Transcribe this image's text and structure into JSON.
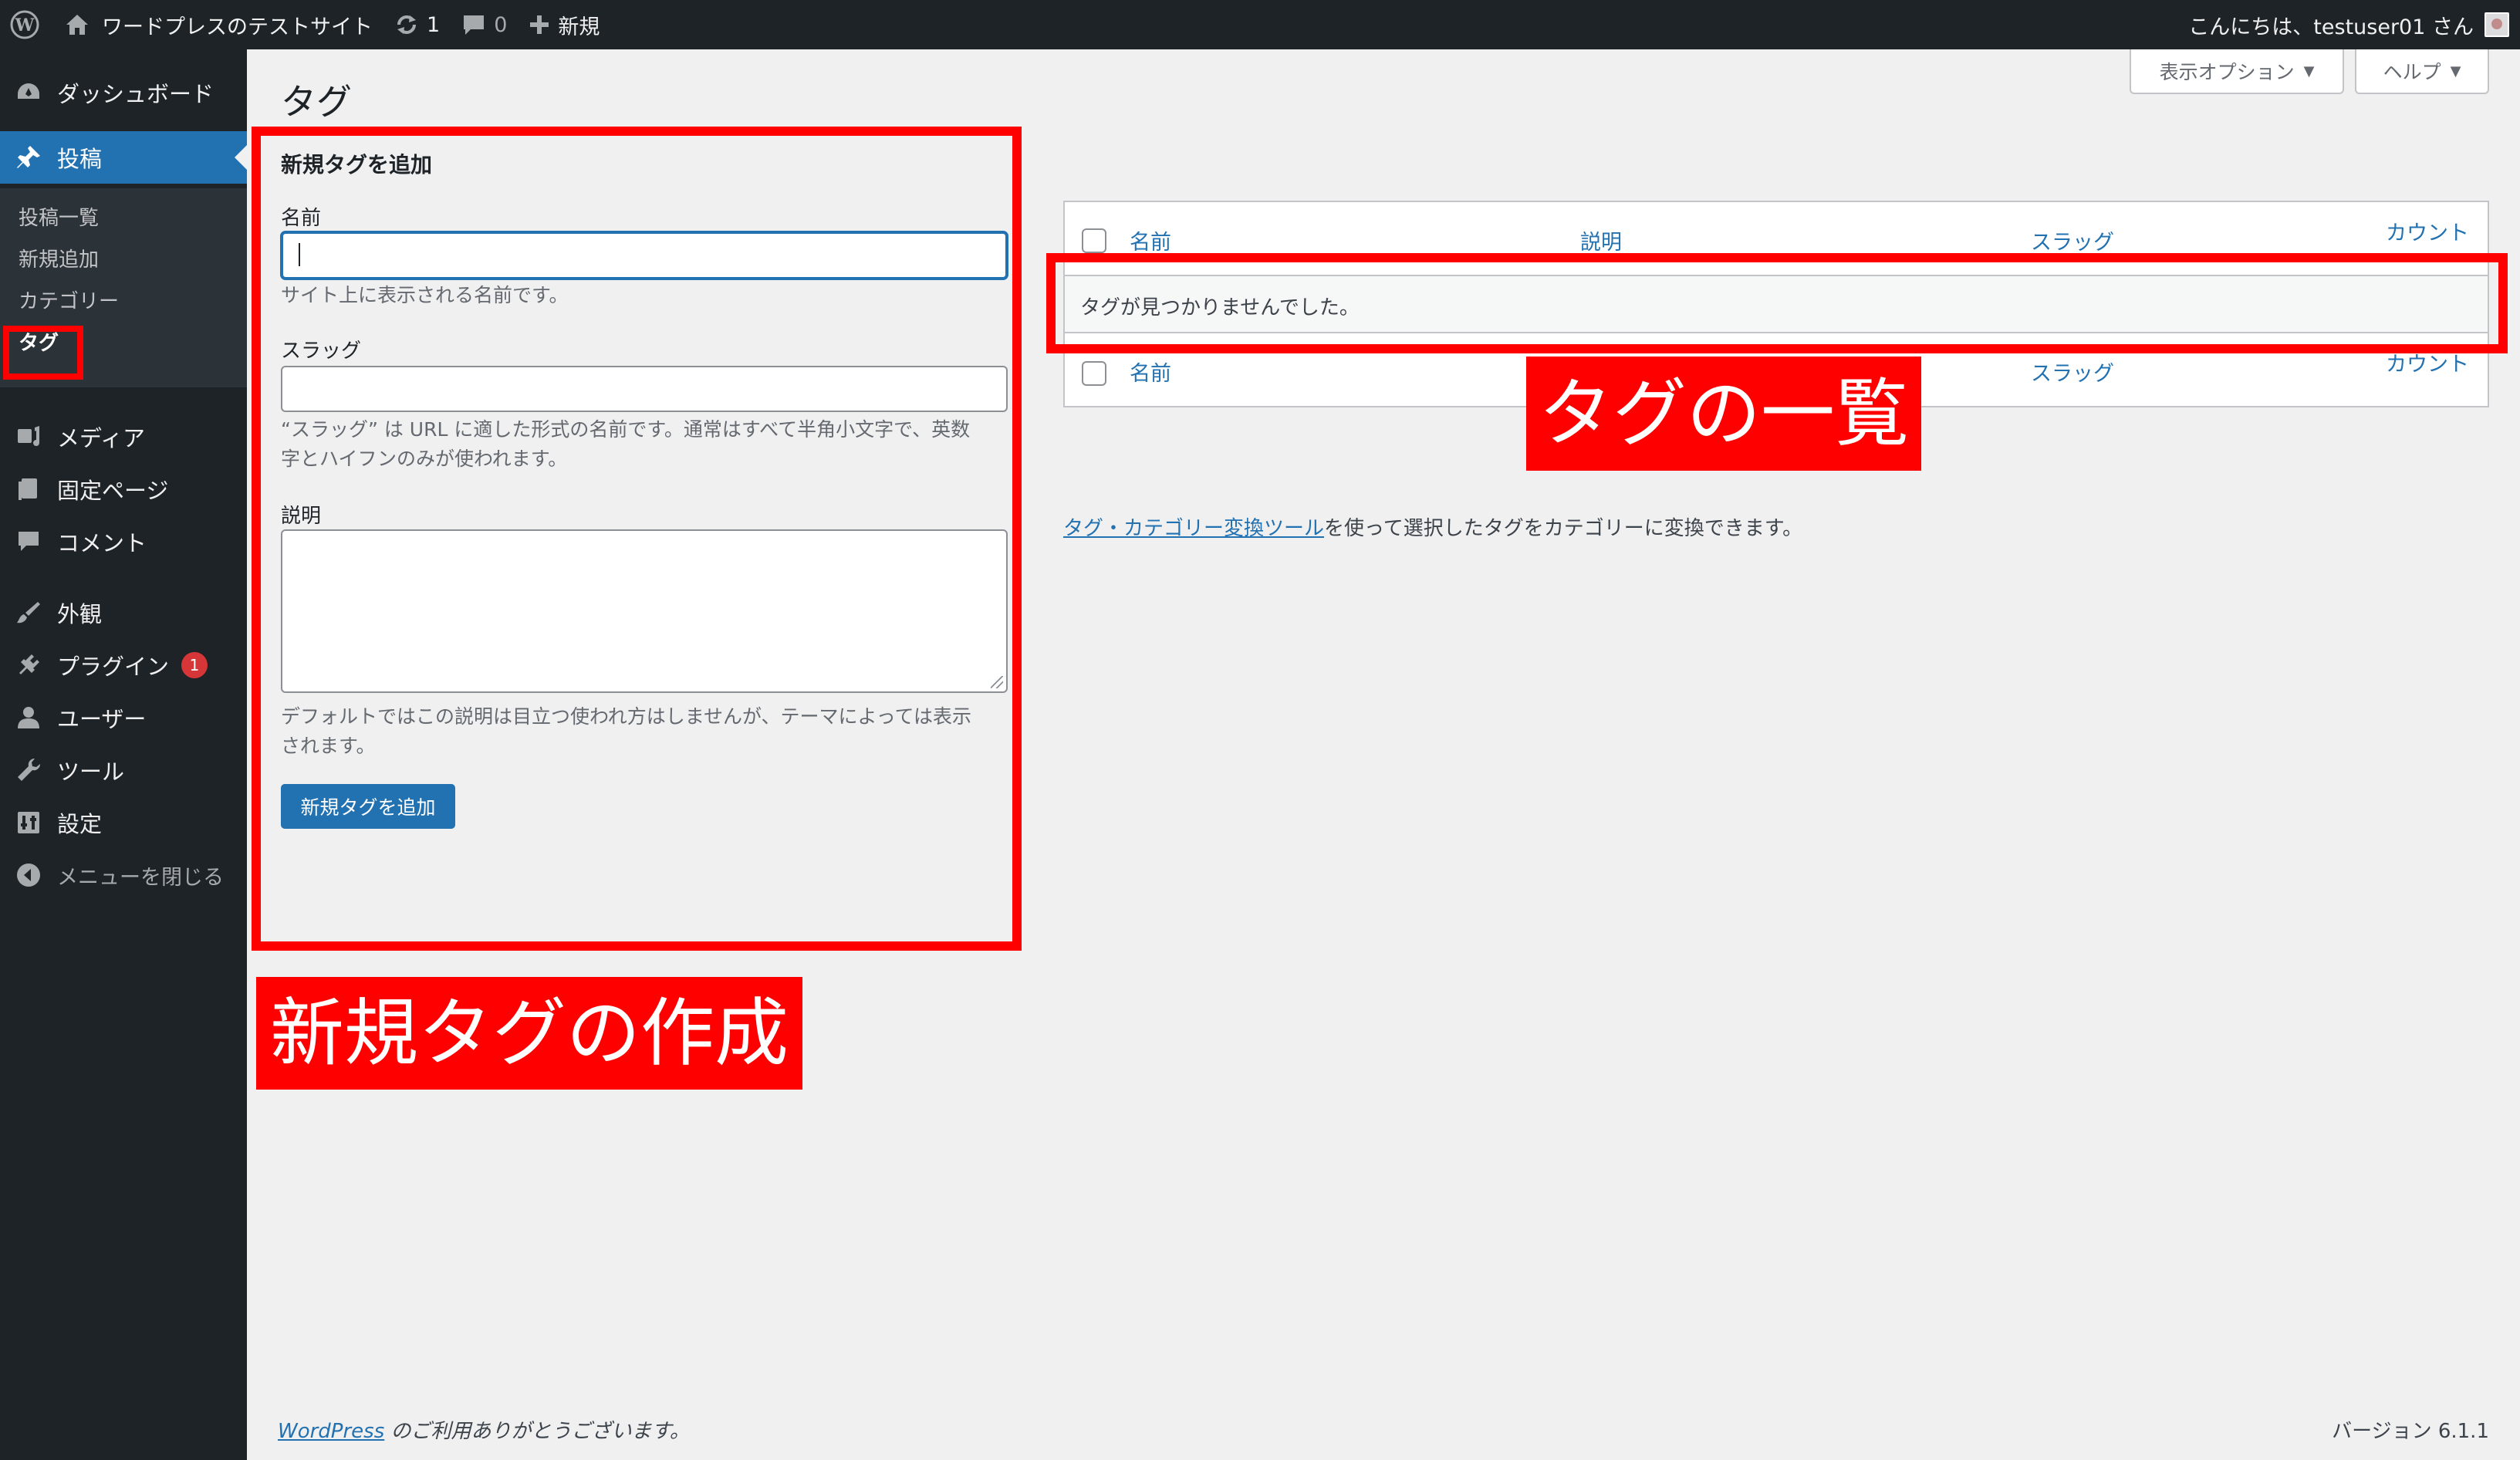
{
  "adminbar": {
    "site_name": "ワードプレスのテストサイト",
    "updates_count": "1",
    "comments_count": "0",
    "new_label": "新規",
    "greeting": "こんにちは、testuser01 さん"
  },
  "sidebar": {
    "items": [
      {
        "label": "ダッシュボード",
        "icon": "dashboard-icon"
      },
      {
        "label": "投稿",
        "icon": "pin-icon"
      },
      {
        "label": "メディア",
        "icon": "media-icon"
      },
      {
        "label": "固定ページ",
        "icon": "page-icon"
      },
      {
        "label": "コメント",
        "icon": "comment-icon"
      },
      {
        "label": "外観",
        "icon": "brush-icon"
      },
      {
        "label": "プラグイン",
        "icon": "plugin-icon",
        "badge": "1"
      },
      {
        "label": "ユーザー",
        "icon": "user-icon"
      },
      {
        "label": "ツール",
        "icon": "wrench-icon"
      },
      {
        "label": "設定",
        "icon": "settings-icon"
      },
      {
        "label": "メニューを閉じる",
        "icon": "collapse-icon"
      }
    ],
    "submenu": [
      "投稿一覧",
      "新規追加",
      "カテゴリー",
      "タグ"
    ]
  },
  "screen_options_label": "表示オプション",
  "help_label": "ヘルプ",
  "page_title": "タグ",
  "add_form": {
    "heading": "新規タグを追加",
    "name_label": "名前",
    "name_hint": "サイト上に表示される名前です。",
    "slug_label": "スラッグ",
    "slug_hint_1": "“スラッグ” は URL に適した形式の名前です。通常はすべて半角小文字で、英数",
    "slug_hint_2": "字とハイフンのみが使われます。",
    "desc_label": "説明",
    "desc_hint_1": "デフォルトではこの説明は目立つ使われ方はしませんが、テーマによっては表示",
    "desc_hint_2": "されます。",
    "submit_label": "新規タグを追加"
  },
  "table": {
    "columns": [
      "名前",
      "説明",
      "スラッグ",
      "カウント"
    ],
    "empty_message": "タグが見つかりませんでした。"
  },
  "converter": {
    "link_text": "タグ・カテゴリー変換ツール",
    "rest_text": "を使って選択したタグをカテゴリーに変換できます。"
  },
  "footer": {
    "link_text": "WordPress",
    "thanks_text": " のご利用ありがとうございます。",
    "version": "バージョン 6.1.1"
  },
  "annotations": {
    "form_label": "新規タグの作成",
    "list_label": "タグの一覧"
  },
  "colors": {
    "admin_bg": "#1d2327",
    "accent": "#2271b1",
    "annotation": "#ff0000"
  }
}
